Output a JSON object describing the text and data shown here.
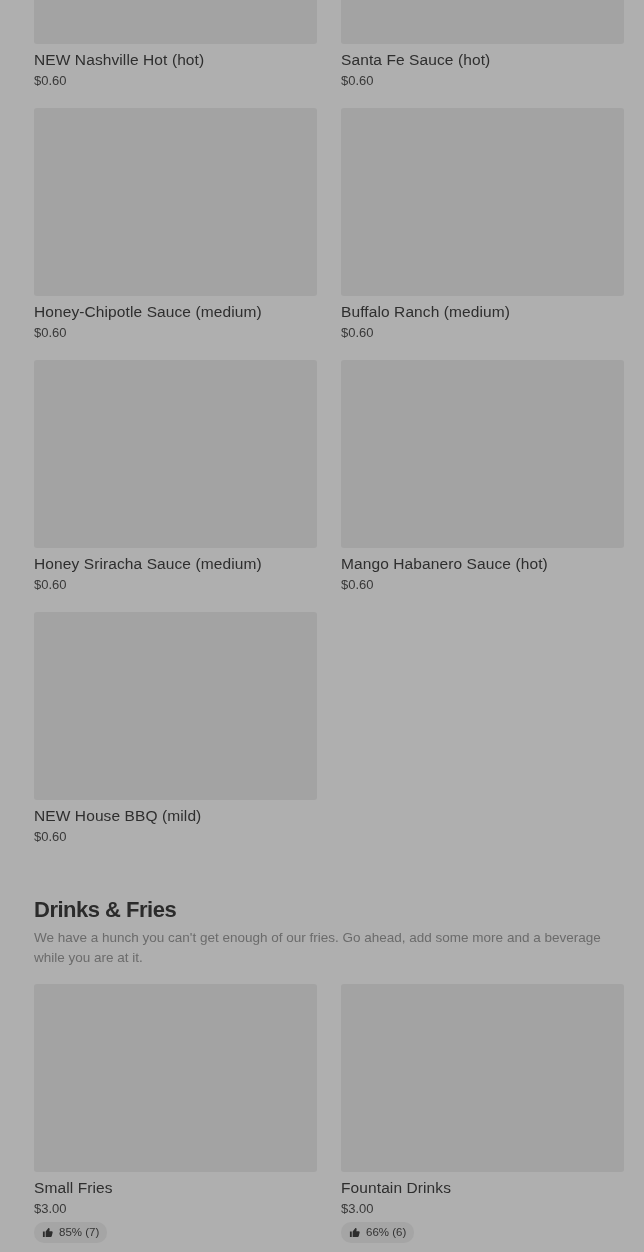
{
  "sections": [
    {
      "items": [
        {
          "name": "NEW Nashville Hot (hot)",
          "price": "$0.60"
        },
        {
          "name": "Santa Fe Sauce (hot)",
          "price": "$0.60"
        },
        {
          "name": "Honey-Chipotle Sauce (medium)",
          "price": "$0.60"
        },
        {
          "name": "Buffalo Ranch (medium)",
          "price": "$0.60"
        },
        {
          "name": "Honey Sriracha Sauce (medium)",
          "price": "$0.60"
        },
        {
          "name": "Mango Habanero Sauce (hot)",
          "price": "$0.60"
        },
        {
          "name": "NEW House BBQ (mild)",
          "price": "$0.60"
        }
      ]
    },
    {
      "title": "Drinks & Fries",
      "description": "We have a hunch you can't get enough of our fries. Go ahead, add some more and a beverage while you are at it.",
      "items": [
        {
          "name": "Small Fries",
          "price": "$3.00",
          "rating": "85% (7)"
        },
        {
          "name": "Fountain Drinks",
          "price": "$3.00",
          "rating": "66% (6)"
        }
      ]
    }
  ]
}
